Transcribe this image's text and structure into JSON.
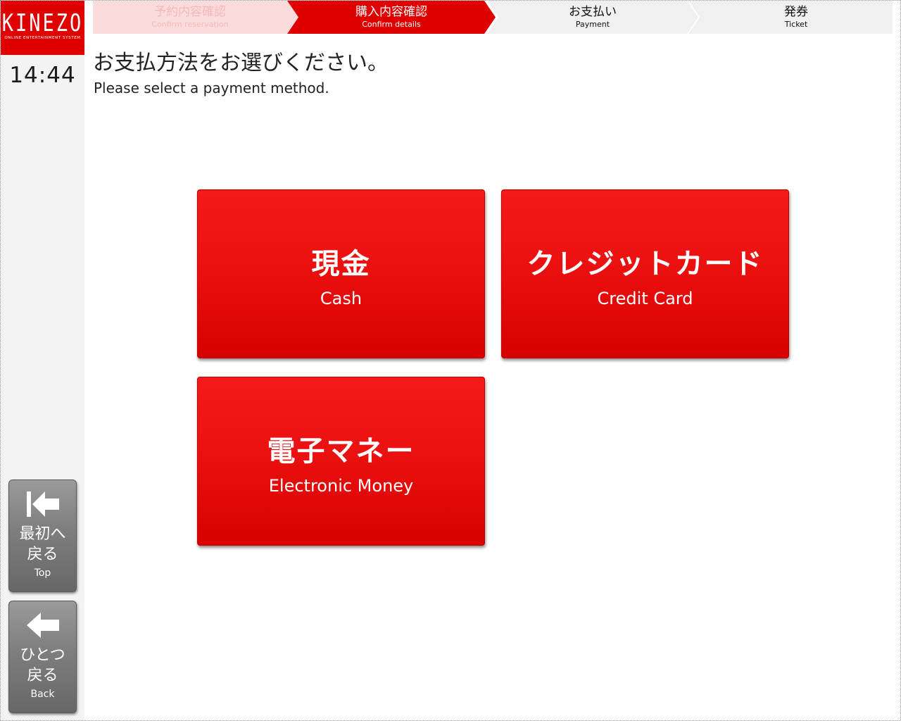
{
  "brand": {
    "logo_text": "KINEZO",
    "logo_subtitle": "ONLINE ENTERTAINMENT SYSTEM",
    "color": "#e00000"
  },
  "clock": "14:44",
  "steps": [
    {
      "label": "予約内容確認",
      "sub": "Confirm reservation",
      "state": "done"
    },
    {
      "label": "購入内容確認",
      "sub": "Confirm details",
      "state": "current"
    },
    {
      "label": "お支払い",
      "sub": "Payment",
      "state": "upcoming"
    },
    {
      "label": "発券",
      "sub": "Ticket",
      "state": "upcoming"
    }
  ],
  "heading": {
    "jp": "お支払方法をお選びください。",
    "en": "Please select a payment method."
  },
  "payment_options": [
    {
      "jp": "現金",
      "en": "Cash"
    },
    {
      "jp": "クレジットカード",
      "en": "Credit Card"
    },
    {
      "jp": "電子マネー",
      "en": "Electronic Money"
    }
  ],
  "nav": {
    "top": {
      "jp_line1": "最初へ",
      "jp_line2": "戻る",
      "en": "Top",
      "icon": "skip-to-start-icon"
    },
    "back": {
      "jp_line1": "ひとつ",
      "jp_line2": "戻る",
      "en": "Back",
      "icon": "arrow-left-icon"
    }
  },
  "colors": {
    "accent": "#e00000",
    "step_done_bg": "#fbdcdc",
    "step_done_text": "#f5b8b8",
    "step_upcoming_bg": "#f0f0f0",
    "side_button": "#7e7e7e"
  }
}
